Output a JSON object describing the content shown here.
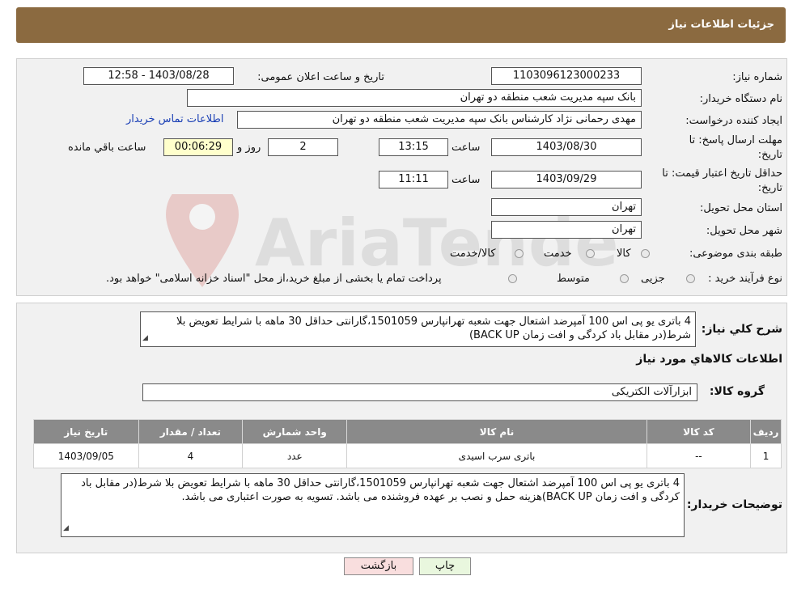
{
  "header": {
    "title": "جزئیات اطلاعات نیاز"
  },
  "form": {
    "need_number_label": "شماره نیاز:",
    "need_number": "1103096123000233",
    "announce_label": "تاریخ و ساعت اعلان عمومی:",
    "announce_value": "1403/08/28 - 12:58",
    "buyer_org_label": "نام دستگاه خریدار:",
    "buyer_org": "بانک سپه مدیریت شعب منطقه دو تهران",
    "creator_label": "ایجاد کننده درخواست:",
    "creator": "مهدی رحمانی نژاد کارشناس بانک سپه مدیریت شعب منطقه دو تهران",
    "contact_link": "اطلاعات تماس خریدار",
    "deadline_label_line1": "مهلت ارسال پاسخ: تا",
    "deadline_label_line2": "تاریخ:",
    "deadline_date": "1403/08/30",
    "time_label": "ساعت",
    "deadline_time": "13:15",
    "days_count": "2",
    "days_label": "روز و",
    "remaining_time": "00:06:29",
    "remaining_label": "ساعت باقي مانده",
    "validity_label_line1": "حداقل تاریخ اعتبار قیمت: تا",
    "validity_label_line2": "تاریخ:",
    "validity_date": "1403/09/29",
    "validity_time": "11:11",
    "province_label": "استان محل تحویل:",
    "province": "تهران",
    "city_label": "شهر محل تحویل:",
    "city": "تهران",
    "category_label": "طبقه بندی موضوعی:",
    "category_options": [
      "کالا",
      "خدمت",
      "کالا/خدمت"
    ],
    "purchase_type_label": "نوع فرآیند خرید :",
    "purchase_options": [
      "جزیی",
      "متوسط"
    ],
    "purchase_note": "پرداخت تمام یا بخشی از مبلغ خرید،از محل \"اسناد خزانه اسلامی\" خواهد بود."
  },
  "summary": {
    "label": "شرح کلي نياز:",
    "text": "4 باتری یو پی اس 100 آمپرضد اشتعال جهت شعبه تهرانپارس 1501059،گارانتی حداقل 30 ماهه با شرایط تعویض بلا شرط(در مقابل باد کردگی و افت زمان BACK UP)",
    "goods_info_title": "اطلاعات کالاهاي مورد نياز",
    "group_label": "گروه کالا:",
    "group_value": "ابزارآلات الکتریکی"
  },
  "table": {
    "headers": [
      "رديف",
      "کد کالا",
      "نام کالا",
      "واحد شمارش",
      "تعداد / مقدار",
      "تاريخ نياز"
    ],
    "rows": [
      [
        "1",
        "--",
        "باتری سرب اسیدی",
        "عدد",
        "4",
        "1403/09/05"
      ]
    ]
  },
  "buyer_notes": {
    "label": "توضیحات خریدار:",
    "text": "4 باتری یو پی اس 100 آمپرضد اشتعال جهت شعبه تهرانپارس 1501059،گارانتی حداقل 30 ماهه با شرایط تعویض بلا شرط(در مقابل باد کردگی و افت زمان BACK UP)هزینه حمل و نصب بر عهده فروشنده می باشد.  تسویه به صورت اعتباری می باشد."
  },
  "buttons": {
    "print": "چاپ",
    "back": "بازگشت"
  },
  "watermark": {
    "text": "AriaTender.neT"
  },
  "colors": {
    "header_bg": "#8b6a40",
    "link": "#1a3fb5",
    "table_header": "#8a8a8a",
    "back_button": "#f9dede",
    "print_button": "#e9f7de"
  }
}
